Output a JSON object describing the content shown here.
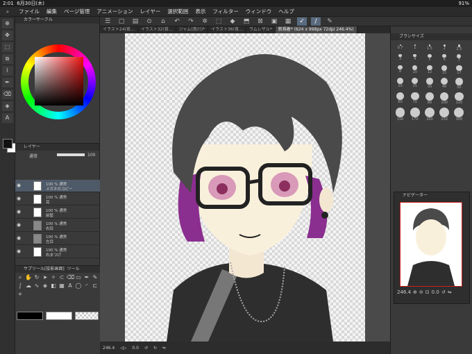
{
  "status": {
    "time": "2:01",
    "date": "6月30日(木)",
    "battery": "91%"
  },
  "menu": [
    "ファイル",
    "編集",
    "ページ管理",
    "アニメーション",
    "レイヤー",
    "選択範囲",
    "表示",
    "フィルター",
    "ウィンドウ",
    "ヘルプ"
  ],
  "tabs": [
    "イラスト24(背…",
    "イラスト32(背…",
    "ジャム(南川)*",
    "イラスト36(背…",
    "ラムレザル*",
    "新規着* (624 x 998px 72dpi 246.4%)"
  ],
  "panels": {
    "color_circle": "カラーサークル",
    "layer": "レイヤー",
    "blend_mode": "通常",
    "opacity": "100",
    "subtool": "サブツール[投影画面]",
    "tool": "ツール",
    "brush_size": "ブラシサイズ",
    "navigator": "ナビゲーター"
  },
  "layers": [
    {
      "pct": "100 % 通常",
      "name": "メガネのコピー",
      "selected": true
    },
    {
      "pct": "100 % 通常",
      "name": "耳",
      "selected": false
    },
    {
      "pct": "100 % 通常",
      "name": "前髪",
      "selected": false
    },
    {
      "pct": "100 % 通常",
      "name": "右目",
      "selected": false
    },
    {
      "pct": "100 % 通常",
      "name": "左目",
      "selected": false
    },
    {
      "pct": "100 % 通常",
      "name": "右まつげ",
      "selected": false
    }
  ],
  "brush_sizes": [
    "0.7",
    "1",
    "1.5",
    "2",
    "2.5",
    "3",
    "4",
    "5",
    "6",
    "7",
    "8",
    "10",
    "12",
    "15",
    "17",
    "20",
    "25",
    "30",
    "40",
    "50",
    "60",
    "70",
    "80",
    "100",
    "120",
    "150",
    "170",
    "200",
    "250",
    "300"
  ],
  "zoom": "246.4",
  "angle": "0.0",
  "nav_zoom": "246.4",
  "nav_angle": "0.0",
  "colors": {
    "accent": "#5a6b80",
    "selected_layer": "#4f5a68"
  }
}
